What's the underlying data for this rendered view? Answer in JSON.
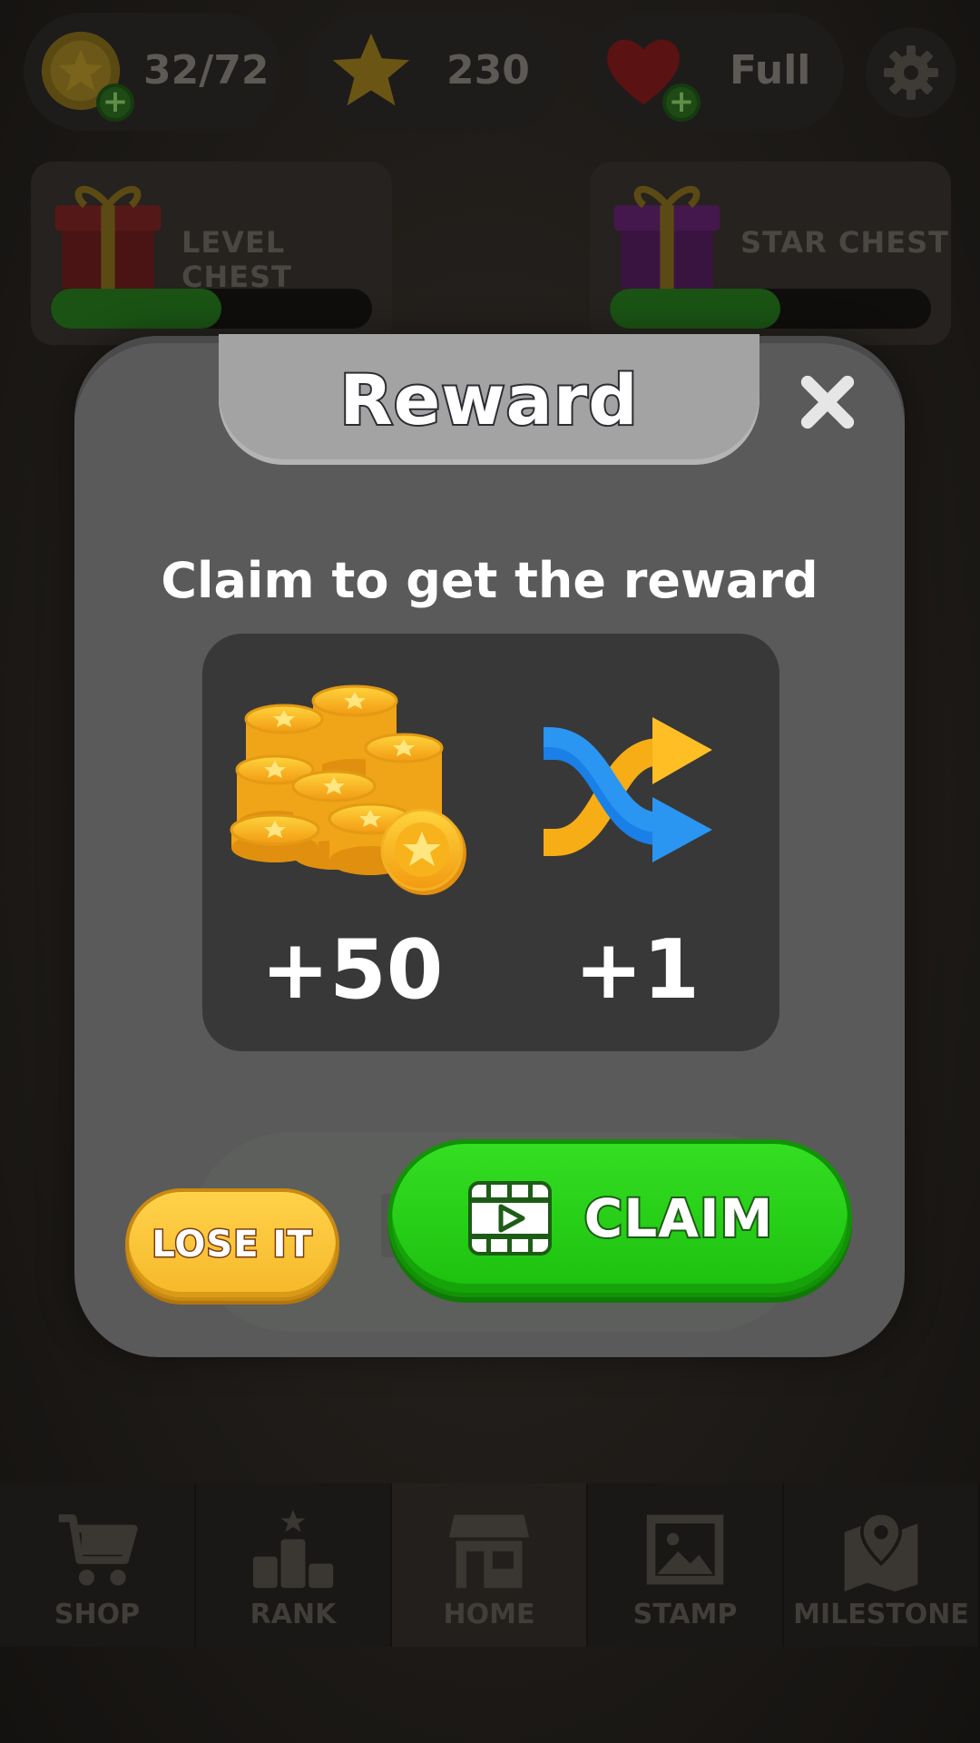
{
  "hud": {
    "coins": {
      "value": "32/72",
      "icon": "coin-icon"
    },
    "stars": {
      "value": "230",
      "icon": "star-icon"
    },
    "lives": {
      "value": "Full",
      "icon": "heart-icon"
    },
    "settings": {
      "icon": "gear-icon"
    }
  },
  "chests": [
    {
      "label": "LEVEL CHEST",
      "progress": 0.53
    },
    {
      "label": "STAR CHEST",
      "progress": 0.53
    }
  ],
  "modal": {
    "title": "Reward",
    "subtitle": "Claim to get the reward",
    "rewards": [
      {
        "icon": "coin-stack-icon",
        "amount": "+50"
      },
      {
        "icon": "shuffle-icon",
        "amount": "+1"
      }
    ],
    "lose_label": "LOSE IT",
    "claim_label": "CLAIM"
  },
  "nav": [
    {
      "label": "SHOP",
      "icon": "cart-icon"
    },
    {
      "label": "RANK",
      "icon": "podium-icon"
    },
    {
      "label": "HOME",
      "icon": "store-icon",
      "active": true
    },
    {
      "label": "STAMP",
      "icon": "stamp-icon"
    },
    {
      "label": "MILESTONE",
      "icon": "map-pin-icon"
    }
  ],
  "colors": {
    "claim_green": "#22c812",
    "lose_yellow": "#f9c233",
    "modal_gray": "#5a5a5a",
    "reward_panel": "#383838"
  }
}
